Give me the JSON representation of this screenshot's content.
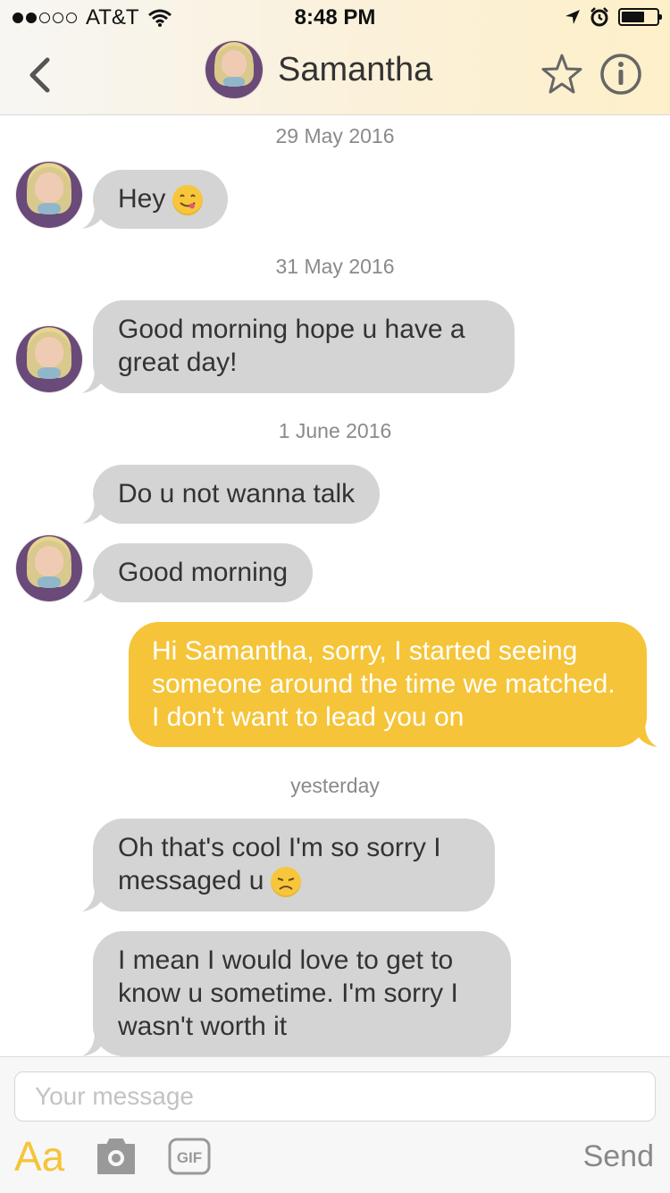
{
  "status_bar": {
    "carrier": "AT&T",
    "time": "8:48 PM"
  },
  "header": {
    "contact_name": "Samantha",
    "icons": [
      "back-chevron-icon",
      "star-icon",
      "info-icon"
    ]
  },
  "conversation": {
    "dates": [
      "29 May 2016",
      "31 May 2016",
      "1 June 2016",
      "yesterday"
    ],
    "messages": [
      {
        "from": "them",
        "text": "Hey",
        "emoji": "yum"
      },
      {
        "from": "them",
        "text": "Good morning hope u have a great day!"
      },
      {
        "from": "them",
        "text": "Do u not wanna talk"
      },
      {
        "from": "them",
        "text": "Good morning"
      },
      {
        "from": "me",
        "text": "Hi Samantha, sorry, I started seeing someone around the time we matched. I don't want to lead you on"
      },
      {
        "from": "them",
        "text": "Oh that's cool I'm so sorry I messaged u",
        "emoji": "disappointed"
      },
      {
        "from": "them",
        "text": "I mean I would love to get to know u sometime. I'm sorry I wasn't worth it"
      }
    ]
  },
  "composer": {
    "placeholder": "Your message",
    "value": "",
    "format_label": "Aa",
    "gif_label": "GIF",
    "send_label": "Send"
  },
  "colors": {
    "accent": "#f5c438",
    "incoming_bubble": "#d4d4d4",
    "outgoing_bubble": "#f5c438"
  }
}
